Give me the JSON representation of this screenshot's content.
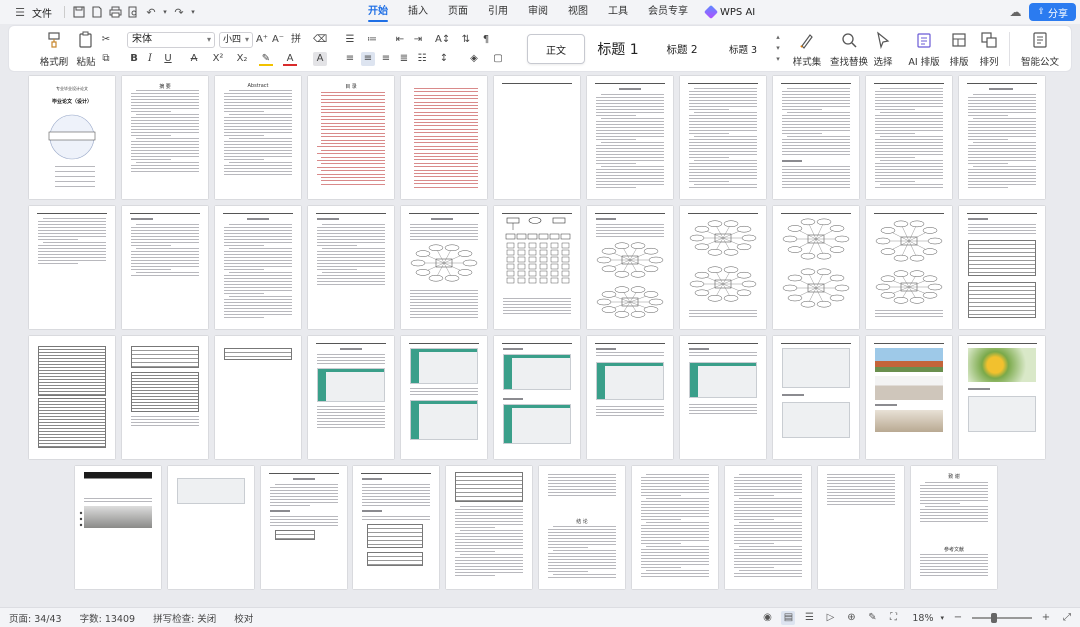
{
  "menubar": {
    "file_label": "文件",
    "tabs": [
      {
        "label": "开始",
        "active": true
      },
      {
        "label": "插入",
        "active": false
      },
      {
        "label": "页面",
        "active": false
      },
      {
        "label": "引用",
        "active": false
      },
      {
        "label": "审阅",
        "active": false
      },
      {
        "label": "视图",
        "active": false
      },
      {
        "label": "工具",
        "active": false
      },
      {
        "label": "会员专享",
        "active": false
      }
    ],
    "wps_ai_label": "WPS AI",
    "share_label": "分享"
  },
  "ribbon": {
    "format_painter_label": "格式刷",
    "paste_label": "粘贴",
    "font_name": "宋体",
    "styles": {
      "normal": "正文",
      "heading1": "标题 1",
      "heading2": "标题 2",
      "heading3": "标题 3"
    },
    "style_set_label": "样式集",
    "find_replace_label": "查找替换",
    "select_label": "选择",
    "ai_layout_label": "AI 排版",
    "layout_label": "排版",
    "arrange_label": "排列",
    "smart_doc_label": "智能公文"
  },
  "document": {
    "cover_title_line1": "专业毕业设计论文",
    "cover_title_line2": "毕业论文（设计）",
    "abstract_cn_title": "摘 要",
    "abstract_en_title": "Abstract",
    "toc_title": "目 录",
    "conclusion_title": "结 论",
    "acknowledgement_title": "致 谢",
    "references_title": "参考文献"
  },
  "statusbar": {
    "page": "页面: 34/43",
    "word_count": "字数: 13409",
    "spell_check": "拼写检查: 关闭",
    "proofread": "校对",
    "zoom": "18%",
    "zoom_level": 0.18
  },
  "colors": {
    "accent": "#1f6fe5",
    "share_button": "#2b7bf0",
    "screenshot_green": "#3a9f8a"
  }
}
